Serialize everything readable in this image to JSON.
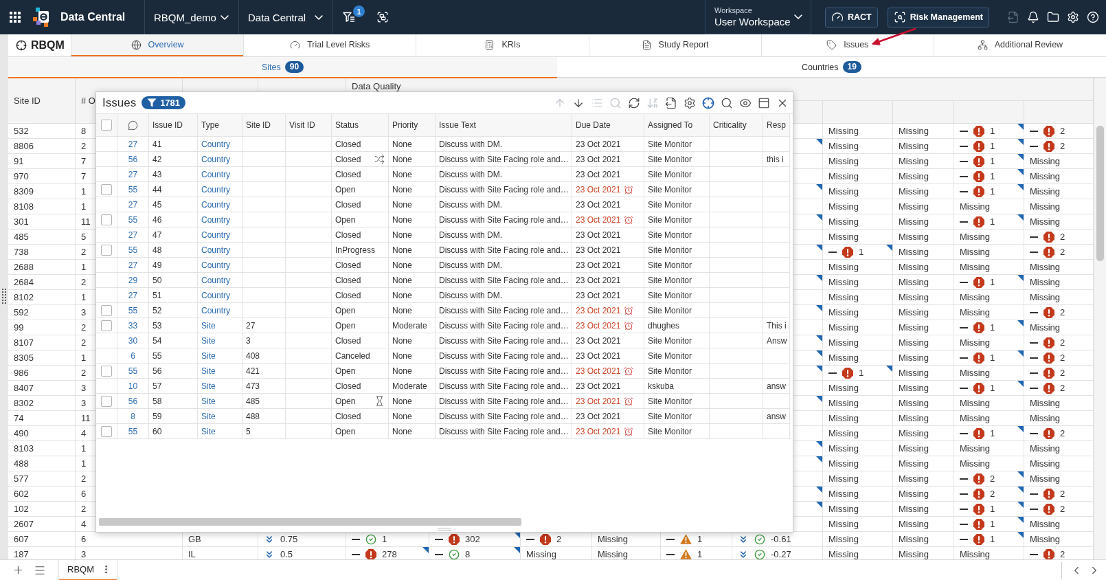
{
  "top_bar": {
    "app_title": "Data Central",
    "selectors": [
      "RBQM_demo",
      "Data Central"
    ],
    "filter_badge": "1",
    "workspace": {
      "label": "Workspace",
      "value": "User Workspace"
    },
    "buttons": [
      "RACT",
      "Risk Management"
    ],
    "icons": [
      {
        "disabled": true
      },
      {
        "disabled": false
      },
      {
        "disabled": false
      },
      {
        "disabled": false
      },
      {
        "disabled": false
      }
    ]
  },
  "module": {
    "title": "RBQM"
  },
  "tabs": [
    {
      "label": "Overview",
      "selected": true
    },
    {
      "label": "Trial Level Risks",
      "selected": false
    },
    {
      "label": "KRIs",
      "selected": false
    },
    {
      "label": "Study Report",
      "selected": false
    },
    {
      "label": "Issues",
      "selected": false
    },
    {
      "label": "Additional Review",
      "selected": false
    }
  ],
  "sub_tabs": [
    {
      "label": "Sites",
      "count": "90",
      "selected": true
    },
    {
      "label": "Countries",
      "count": "19",
      "selected": false
    }
  ],
  "grid": {
    "columns": [
      "Site ID",
      "# O"
    ],
    "group_header": "Data Quality",
    "rows": [
      {
        "site_id": "532",
        "column_2": "8",
        "cells": [
          {
            "kind": "blank",
            "flagged": false
          },
          {
            "kind": "text",
            "text": "Missing",
            "flagged": false
          },
          {
            "kind": "text",
            "text": "Missing",
            "flagged": false
          },
          {
            "kind": "alert",
            "text": "1",
            "flagged": true
          },
          {
            "kind": "alert",
            "text": "2",
            "flagged": false
          }
        ]
      },
      {
        "site_id": "8806",
        "column_2": "2",
        "cells": [
          {
            "kind": "blank",
            "flagged": true
          },
          {
            "kind": "text",
            "text": "Missing",
            "flagged": false
          },
          {
            "kind": "text",
            "text": "Missing",
            "flagged": false
          },
          {
            "kind": "alert",
            "text": "1",
            "flagged": true
          },
          {
            "kind": "alert",
            "text": "2",
            "flagged": false
          }
        ]
      },
      {
        "site_id": "91",
        "column_2": "7",
        "cells": [
          {
            "kind": "blank",
            "flagged": false
          },
          {
            "kind": "text",
            "text": "Missing",
            "flagged": false
          },
          {
            "kind": "text",
            "text": "Missing",
            "flagged": false
          },
          {
            "kind": "alert",
            "text": "1",
            "flagged": true
          },
          {
            "kind": "text",
            "text": "Missing",
            "flagged": false
          }
        ]
      },
      {
        "site_id": "970",
        "column_2": "7",
        "cells": [
          {
            "kind": "blank",
            "flagged": false
          },
          {
            "kind": "text",
            "text": "Missing",
            "flagged": false
          },
          {
            "kind": "text",
            "text": "Missing",
            "flagged": false
          },
          {
            "kind": "alert",
            "text": "1",
            "flagged": true
          },
          {
            "kind": "text",
            "text": "Missing",
            "flagged": false
          }
        ]
      },
      {
        "site_id": "8309",
        "column_2": "1",
        "cells": [
          {
            "kind": "blank",
            "flagged": true
          },
          {
            "kind": "text",
            "text": "Missing",
            "flagged": false
          },
          {
            "kind": "text",
            "text": "Missing",
            "flagged": false
          },
          {
            "kind": "alert",
            "text": "1",
            "flagged": true
          },
          {
            "kind": "text",
            "text": "Missing",
            "flagged": false
          }
        ]
      },
      {
        "site_id": "8108",
        "column_2": "1",
        "cells": [
          {
            "kind": "blank",
            "flagged": false
          },
          {
            "kind": "text",
            "text": "Missing",
            "flagged": false
          },
          {
            "kind": "text",
            "text": "Missing",
            "flagged": false
          },
          {
            "kind": "text",
            "text": "Missing",
            "flagged": false
          },
          {
            "kind": "text",
            "text": "Missing",
            "flagged": false
          }
        ]
      },
      {
        "site_id": "301",
        "column_2": "11",
        "cells": [
          {
            "kind": "blank",
            "flagged": true
          },
          {
            "kind": "text",
            "text": "Missing",
            "flagged": false
          },
          {
            "kind": "text",
            "text": "Missing",
            "flagged": false
          },
          {
            "kind": "alert",
            "text": "1",
            "flagged": true
          },
          {
            "kind": "text",
            "text": "Missing",
            "flagged": false
          }
        ]
      },
      {
        "site_id": "485",
        "column_2": "5",
        "cells": [
          {
            "kind": "blank",
            "flagged": false
          },
          {
            "kind": "text",
            "text": "Missing",
            "flagged": false
          },
          {
            "kind": "text",
            "text": "Missing",
            "flagged": false
          },
          {
            "kind": "text",
            "text": "Missing",
            "flagged": false
          },
          {
            "kind": "alert",
            "text": "2",
            "flagged": false
          }
        ]
      },
      {
        "site_id": "738",
        "column_2": "2",
        "cells": [
          {
            "kind": "blank",
            "flagged": true
          },
          {
            "kind": "alert",
            "text": "1",
            "flagged": true
          },
          {
            "kind": "text",
            "text": "Missing",
            "flagged": false
          },
          {
            "kind": "text",
            "text": "Missing",
            "flagged": false
          },
          {
            "kind": "alert",
            "text": "2",
            "flagged": false
          }
        ]
      },
      {
        "site_id": "2688",
        "column_2": "1",
        "cells": [
          {
            "kind": "blank",
            "flagged": false
          },
          {
            "kind": "text",
            "text": "Missing",
            "flagged": false
          },
          {
            "kind": "text",
            "text": "Missing",
            "flagged": false
          },
          {
            "kind": "text",
            "text": "Missing",
            "flagged": false
          },
          {
            "kind": "text",
            "text": "Missing",
            "flagged": false
          }
        ]
      },
      {
        "site_id": "2684",
        "column_2": "2",
        "cells": [
          {
            "kind": "blank",
            "flagged": true
          },
          {
            "kind": "text",
            "text": "Missing",
            "flagged": false
          },
          {
            "kind": "text",
            "text": "Missing",
            "flagged": false
          },
          {
            "kind": "alert",
            "text": "1",
            "flagged": true
          },
          {
            "kind": "text",
            "text": "Missing",
            "flagged": false
          }
        ]
      },
      {
        "site_id": "8102",
        "column_2": "1",
        "cells": [
          {
            "kind": "blank",
            "flagged": false
          },
          {
            "kind": "text",
            "text": "Missing",
            "flagged": false
          },
          {
            "kind": "text",
            "text": "Missing",
            "flagged": false
          },
          {
            "kind": "text",
            "text": "Missing",
            "flagged": false
          },
          {
            "kind": "text",
            "text": "Missing",
            "flagged": false
          }
        ]
      },
      {
        "site_id": "592",
        "column_2": "3",
        "cells": [
          {
            "kind": "blank",
            "flagged": true
          },
          {
            "kind": "text",
            "text": "Missing",
            "flagged": false
          },
          {
            "kind": "text",
            "text": "Missing",
            "flagged": false
          },
          {
            "kind": "text",
            "text": "Missing",
            "flagged": false
          },
          {
            "kind": "alert",
            "text": "2",
            "flagged": false
          }
        ]
      },
      {
        "site_id": "99",
        "column_2": "2",
        "cells": [
          {
            "kind": "blank",
            "flagged": false
          },
          {
            "kind": "text",
            "text": "Missing",
            "flagged": false
          },
          {
            "kind": "text",
            "text": "Missing",
            "flagged": false
          },
          {
            "kind": "alert",
            "text": "1",
            "flagged": true
          },
          {
            "kind": "text",
            "text": "Missing",
            "flagged": false
          }
        ]
      },
      {
        "site_id": "8107",
        "column_2": "2",
        "cells": [
          {
            "kind": "blank",
            "flagged": true
          },
          {
            "kind": "text",
            "text": "Missing",
            "flagged": false
          },
          {
            "kind": "text",
            "text": "Missing",
            "flagged": false
          },
          {
            "kind": "text",
            "text": "Missing",
            "flagged": false
          },
          {
            "kind": "alert",
            "text": "2",
            "flagged": false
          }
        ]
      },
      {
        "site_id": "8305",
        "column_2": "1",
        "cells": [
          {
            "kind": "blank",
            "flagged": true
          },
          {
            "kind": "text",
            "text": "Missing",
            "flagged": false
          },
          {
            "kind": "text",
            "text": "Missing",
            "flagged": false
          },
          {
            "kind": "alert",
            "text": "1",
            "flagged": true
          },
          {
            "kind": "alert",
            "text": "2",
            "flagged": false
          }
        ]
      },
      {
        "site_id": "986",
        "column_2": "2",
        "cells": [
          {
            "kind": "blank",
            "flagged": true
          },
          {
            "kind": "alert",
            "text": "1",
            "flagged": true
          },
          {
            "kind": "text",
            "text": "Missing",
            "flagged": false
          },
          {
            "kind": "text",
            "text": "Missing",
            "flagged": false
          },
          {
            "kind": "alert",
            "text": "2",
            "flagged": false
          }
        ]
      },
      {
        "site_id": "8407",
        "column_2": "3",
        "cells": [
          {
            "kind": "blank",
            "flagged": false
          },
          {
            "kind": "text",
            "text": "Missing",
            "flagged": false
          },
          {
            "kind": "text",
            "text": "Missing",
            "flagged": false
          },
          {
            "kind": "alert",
            "text": "1",
            "flagged": true
          },
          {
            "kind": "alert",
            "text": "2",
            "flagged": false
          }
        ]
      },
      {
        "site_id": "8302",
        "column_2": "3",
        "cells": [
          {
            "kind": "blank",
            "flagged": true
          },
          {
            "kind": "text",
            "text": "Missing",
            "flagged": false
          },
          {
            "kind": "text",
            "text": "Missing",
            "flagged": false
          },
          {
            "kind": "text",
            "text": "Missing",
            "flagged": false
          },
          {
            "kind": "text",
            "text": "Missing",
            "flagged": false
          }
        ]
      },
      {
        "site_id": "74",
        "column_2": "11",
        "cells": [
          {
            "kind": "blank",
            "flagged": false
          },
          {
            "kind": "text",
            "text": "Missing",
            "flagged": false
          },
          {
            "kind": "text",
            "text": "Missing",
            "flagged": false
          },
          {
            "kind": "text",
            "text": "Missing",
            "flagged": false
          },
          {
            "kind": "text",
            "text": "Missing",
            "flagged": false
          }
        ]
      },
      {
        "site_id": "490",
        "column_2": "4",
        "cells": [
          {
            "kind": "blank",
            "flagged": false
          },
          {
            "kind": "text",
            "text": "Missing",
            "flagged": false
          },
          {
            "kind": "text",
            "text": "Missing",
            "flagged": false
          },
          {
            "kind": "alert",
            "text": "1",
            "flagged": true
          },
          {
            "kind": "alert",
            "text": "2",
            "flagged": false
          }
        ]
      },
      {
        "site_id": "8103",
        "column_2": "1",
        "cells": [
          {
            "kind": "blank",
            "flagged": true
          },
          {
            "kind": "text",
            "text": "Missing",
            "flagged": false
          },
          {
            "kind": "text",
            "text": "Missing",
            "flagged": false
          },
          {
            "kind": "text",
            "text": "Missing",
            "flagged": false
          },
          {
            "kind": "text",
            "text": "Missing",
            "flagged": false
          }
        ]
      },
      {
        "site_id": "488",
        "column_2": "1",
        "cells": [
          {
            "kind": "blank",
            "flagged": true
          },
          {
            "kind": "text",
            "text": "Missing",
            "flagged": false
          },
          {
            "kind": "text",
            "text": "Missing",
            "flagged": false
          },
          {
            "kind": "text",
            "text": "Missing",
            "flagged": false
          },
          {
            "kind": "text",
            "text": "Missing",
            "flagged": false
          }
        ]
      },
      {
        "site_id": "577",
        "column_2": "2",
        "cells": [
          {
            "kind": "blank",
            "flagged": false
          },
          {
            "kind": "text",
            "text": "Missing",
            "flagged": false
          },
          {
            "kind": "text",
            "text": "Missing",
            "flagged": false
          },
          {
            "kind": "alert",
            "text": "2",
            "flagged": true
          },
          {
            "kind": "text",
            "text": "Missing",
            "flagged": false
          }
        ]
      },
      {
        "site_id": "602",
        "column_2": "6",
        "cells": [
          {
            "kind": "blank",
            "flagged": true
          },
          {
            "kind": "text",
            "text": "Missing",
            "flagged": false
          },
          {
            "kind": "text",
            "text": "Missing",
            "flagged": false
          },
          {
            "kind": "alert",
            "text": "2",
            "flagged": true
          },
          {
            "kind": "alert",
            "text": "2",
            "flagged": false
          }
        ]
      },
      {
        "site_id": "102",
        "column_2": "2",
        "cells": [
          {
            "kind": "blank",
            "flagged": true
          },
          {
            "kind": "text",
            "text": "Missing",
            "flagged": false
          },
          {
            "kind": "text",
            "text": "Missing",
            "flagged": false
          },
          {
            "kind": "alert",
            "text": "1",
            "flagged": true
          },
          {
            "kind": "alert",
            "text": "2",
            "flagged": false
          }
        ]
      },
      {
        "site_id": "2607",
        "column_2": "4",
        "cells": [
          {
            "kind": "blank",
            "flagged": false
          },
          {
            "kind": "text",
            "text": "Missing",
            "flagged": false
          },
          {
            "kind": "text",
            "text": "Missing",
            "flagged": false
          },
          {
            "kind": "alert",
            "text": "1",
            "flagged": true
          },
          {
            "kind": "text",
            "text": "Missing",
            "flagged": false
          }
        ]
      },
      {
        "site_id": "607",
        "column_2": "6",
        "cells": [
          {
            "kind": "text",
            "text": "GB",
            "flagged": false
          },
          {
            "kind": "trend",
            "text": "0.75",
            "flagged": false
          },
          {
            "kind": "ok",
            "text": "1",
            "flagged": false
          },
          {
            "kind": "alert",
            "text": "302",
            "flagged": true
          },
          {
            "kind": "alert",
            "text": "2",
            "flagged": false
          },
          {
            "kind": "text",
            "text": "Missing",
            "flagged": false
          },
          {
            "kind": "warning",
            "text": "1",
            "flagged": false
          },
          {
            "kind": "score",
            "text": "-0.61",
            "flagged": false
          },
          {
            "kind": "text",
            "text": "Missing",
            "flagged": false
          },
          {
            "kind": "text",
            "text": "Missing",
            "flagged": false
          },
          {
            "kind": "alert",
            "text": "1",
            "flagged": true
          },
          {
            "kind": "text",
            "text": "Missing",
            "flagged": false
          }
        ]
      },
      {
        "site_id": "187",
        "column_2": "3",
        "cells": [
          {
            "kind": "text",
            "text": "IL",
            "flagged": false
          },
          {
            "kind": "trend",
            "text": "0.5",
            "flagged": false
          },
          {
            "kind": "alert",
            "text": "278",
            "flagged": true
          },
          {
            "kind": "ok",
            "text": "8",
            "flagged": true
          },
          {
            "kind": "text",
            "text": "Missing",
            "flagged": false
          },
          {
            "kind": "text",
            "text": "Missing",
            "flagged": false
          },
          {
            "kind": "warning",
            "text": "1",
            "flagged": false
          },
          {
            "kind": "score",
            "text": "-0.27",
            "flagged": false
          },
          {
            "kind": "text",
            "text": "Missing",
            "flagged": false
          },
          {
            "kind": "text",
            "text": "Missing",
            "flagged": false
          },
          {
            "kind": "text",
            "text": "Missing",
            "flagged": false
          },
          {
            "kind": "alert",
            "text": "2",
            "flagged": false
          }
        ]
      }
    ]
  },
  "issues_panel": {
    "title": "Issues",
    "count": "1781",
    "toolbar": [
      {
        "disabled": true,
        "on": false
      },
      {
        "disabled": false,
        "on": false
      },
      {
        "disabled": true,
        "on": false
      },
      {
        "disabled": true,
        "on": false
      },
      {
        "disabled": false,
        "on": false
      },
      {
        "disabled": true,
        "on": false
      },
      {
        "disabled": false,
        "on": false
      },
      {
        "disabled": false,
        "on": false
      },
      {
        "disabled": false,
        "on": true
      },
      {
        "disabled": false,
        "on": false
      },
      {
        "disabled": false,
        "on": false
      },
      {
        "disabled": false,
        "on": false
      },
      {
        "disabled": false,
        "on": false
      }
    ],
    "select_all": {
      "checked": false
    },
    "columns": [
      "Issue ID",
      "Type",
      "Site ID",
      "Visit ID",
      "Status",
      "Priority",
      "Issue Text",
      "Due Date",
      "Assigned To",
      "Criticality",
      "Resp"
    ],
    "rows": [
      {
        "kind": "plain",
        "comments": "27",
        "issue_id": "41",
        "type": "Country",
        "status": "Closed",
        "priority": "None",
        "issue_text": "Discuss with DM.",
        "due_date": "23 Oct 2021",
        "overdue": false,
        "assigned_to": "Site Monitor"
      },
      {
        "kind": "shuffle",
        "comments": "56",
        "issue_id": "42",
        "type": "Country",
        "status": "Closed",
        "priority": "None",
        "issue_text": "Discuss with Site Facing role and…",
        "due_date": "23 Oct 2021",
        "overdue": false,
        "assigned_to": "Site Monitor",
        "response": "this i"
      },
      {
        "kind": "plain",
        "comments": "27",
        "issue_id": "43",
        "type": "Country",
        "status": "Closed",
        "priority": "None",
        "issue_text": "Discuss with DM.",
        "due_date": "23 Oct 2021",
        "overdue": false,
        "assigned_to": "Site Monitor"
      },
      {
        "kind": "plain",
        "checked": false,
        "comments": "55",
        "issue_id": "44",
        "type": "Country",
        "status": "Open",
        "priority": "None",
        "issue_text": "Discuss with Site Facing role and…",
        "due_date": "23 Oct 2021",
        "overdue": true,
        "assigned_to": "Site Monitor"
      },
      {
        "kind": "plain",
        "comments": "27",
        "issue_id": "45",
        "type": "Country",
        "status": "Closed",
        "priority": "None",
        "issue_text": "Discuss with DM.",
        "due_date": "23 Oct 2021",
        "overdue": false,
        "assigned_to": "Site Monitor"
      },
      {
        "kind": "plain",
        "checked": false,
        "comments": "55",
        "issue_id": "46",
        "type": "Country",
        "status": "Open",
        "priority": "None",
        "issue_text": "Discuss with Site Facing role and…",
        "due_date": "23 Oct 2021",
        "overdue": true,
        "assigned_to": "Site Monitor"
      },
      {
        "kind": "plain",
        "comments": "27",
        "issue_id": "47",
        "type": "Country",
        "status": "Closed",
        "priority": "None",
        "issue_text": "Discuss with DM.",
        "due_date": "23 Oct 2021",
        "overdue": false,
        "assigned_to": "Site Monitor"
      },
      {
        "kind": "plain",
        "checked": false,
        "comments": "55",
        "issue_id": "48",
        "type": "Country",
        "status": "InProgress",
        "priority": "None",
        "issue_text": "Discuss with Site Facing role and…",
        "due_date": "23 Oct 2021",
        "overdue": false,
        "assigned_to": "Site Monitor"
      },
      {
        "kind": "plain",
        "comments": "27",
        "issue_id": "49",
        "type": "Country",
        "status": "Closed",
        "priority": "None",
        "issue_text": "Discuss with DM.",
        "due_date": "23 Oct 2021",
        "overdue": false,
        "assigned_to": "Site Monitor"
      },
      {
        "kind": "plain",
        "comments": "29",
        "issue_id": "50",
        "type": "Country",
        "status": "Closed",
        "priority": "None",
        "issue_text": "Discuss with Site Facing role and…",
        "due_date": "23 Oct 2021",
        "overdue": false,
        "assigned_to": "Site Monitor"
      },
      {
        "kind": "plain",
        "comments": "27",
        "issue_id": "51",
        "type": "Country",
        "status": "Closed",
        "priority": "None",
        "issue_text": "Discuss with DM.",
        "due_date": "23 Oct 2021",
        "overdue": false,
        "assigned_to": "Site Monitor"
      },
      {
        "kind": "plain",
        "checked": false,
        "comments": "55",
        "issue_id": "52",
        "type": "Country",
        "status": "Open",
        "priority": "None",
        "issue_text": "Discuss with Site Facing role and…",
        "due_date": "23 Oct 2021",
        "overdue": true,
        "assigned_to": "Site Monitor"
      },
      {
        "kind": "plain",
        "checked": false,
        "comments": "33",
        "issue_id": "53",
        "type": "Site",
        "site_id": "27",
        "status": "Open",
        "priority": "Moderate",
        "issue_text": "Discuss with Site Facing role and…",
        "due_date": "23 Oct 2021",
        "overdue": true,
        "assigned_to": "dhughes",
        "response": "This i"
      },
      {
        "kind": "plain",
        "comments": "30",
        "issue_id": "54",
        "type": "Site",
        "site_id": "3",
        "status": "Closed",
        "priority": "None",
        "issue_text": "Discuss with Site Facing role and…",
        "due_date": "23 Oct 2021",
        "overdue": false,
        "assigned_to": "Site Monitor",
        "response": "Answ"
      },
      {
        "kind": "plain",
        "comments": "6",
        "issue_id": "55",
        "type": "Site",
        "site_id": "408",
        "status": "Canceled",
        "priority": "None",
        "issue_text": "Discuss with Site Facing role and…",
        "due_date": "23 Oct 2021",
        "overdue": false,
        "assigned_to": "Site Monitor"
      },
      {
        "kind": "plain",
        "checked": false,
        "comments": "55",
        "issue_id": "56",
        "type": "Site",
        "site_id": "421",
        "status": "Open",
        "priority": "None",
        "issue_text": "Discuss with Site Facing role and…",
        "due_date": "23 Oct 2021",
        "overdue": true,
        "assigned_to": "Site Monitor"
      },
      {
        "kind": "plain",
        "comments": "10",
        "issue_id": "57",
        "type": "Site",
        "site_id": "473",
        "status": "Closed",
        "priority": "Moderate",
        "issue_text": "Discuss with Site Facing role and…",
        "due_date": "23 Oct 2021",
        "overdue": false,
        "assigned_to": "kskuba",
        "response": "answ"
      },
      {
        "kind": "timer",
        "checked": false,
        "comments": "56",
        "issue_id": "58",
        "type": "Site",
        "site_id": "485",
        "status": "Open",
        "priority": "None",
        "issue_text": "Discuss with Site Facing role and…",
        "due_date": "23 Oct 2021",
        "overdue": true,
        "assigned_to": "Site Monitor"
      },
      {
        "kind": "plain",
        "comments": "8",
        "issue_id": "59",
        "type": "Site",
        "site_id": "488",
        "status": "Closed",
        "priority": "None",
        "issue_text": "Discuss with Site Facing role and…",
        "due_date": "23 Oct 2021",
        "overdue": false,
        "assigned_to": "Site Monitor",
        "response": "answ"
      },
      {
        "kind": "plain",
        "checked": false,
        "comments": "55",
        "issue_id": "60",
        "type": "Site",
        "site_id": "5",
        "status": "Open",
        "priority": "None",
        "issue_text": "Discuss with Site Facing role and…",
        "due_date": "23 Oct 2021",
        "overdue": true,
        "assigned_to": "Site Monitor"
      }
    ]
  },
  "bottom_bar": {
    "tabs": [
      {
        "label": "RBQM",
        "selected": true
      }
    ]
  }
}
